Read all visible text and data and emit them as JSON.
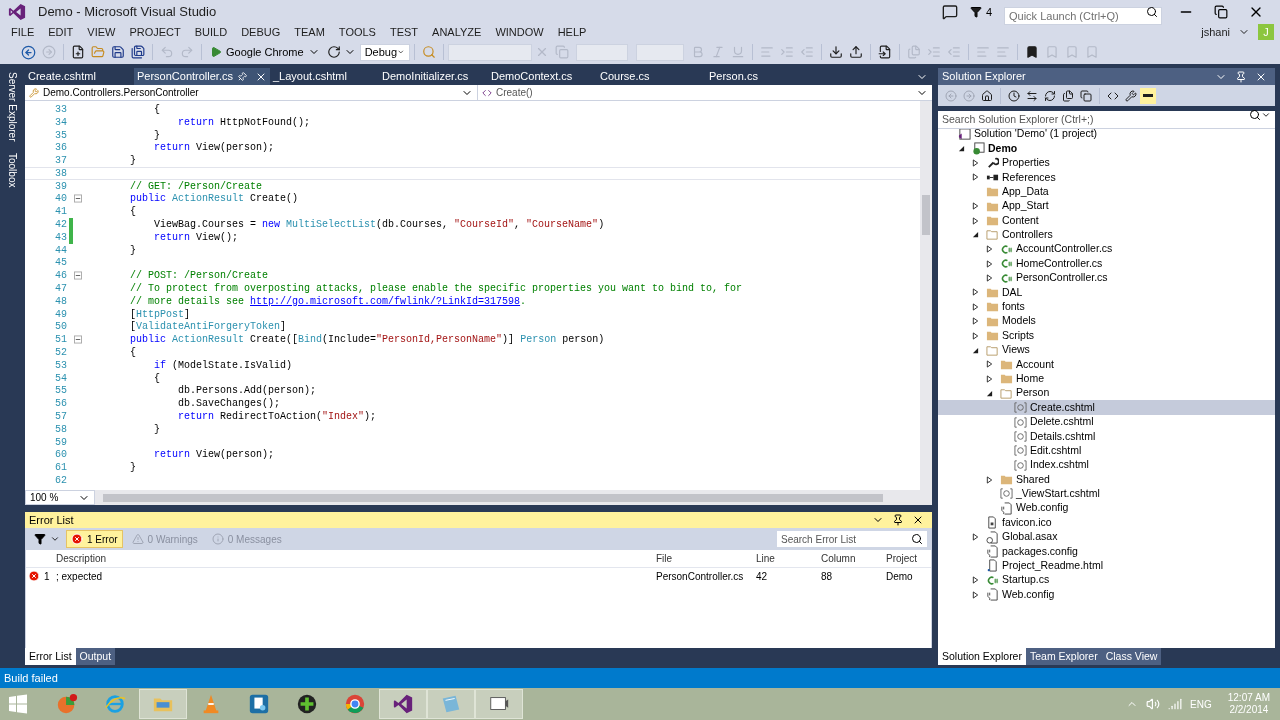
{
  "window": {
    "title": "Demo - Microsoft Visual Studio"
  },
  "title_bar": {
    "notification_count": "4",
    "quick_launch": {
      "placeholder": "Quick Launch (Ctrl+Q)"
    },
    "user": {
      "name": "jshani",
      "initial": "J"
    }
  },
  "menu": [
    "FILE",
    "EDIT",
    "VIEW",
    "PROJECT",
    "BUILD",
    "DEBUG",
    "TEAM",
    "TOOLS",
    "TEST",
    "ANALYZE",
    "WINDOW",
    "HELP"
  ],
  "toolbar": {
    "run_target": "Google Chrome",
    "configuration": "Debug"
  },
  "side_tabs": [
    "Server Explorer",
    "Toolbox"
  ],
  "editor": {
    "tabs": [
      {
        "label": "Create.cshtml",
        "selected": false
      },
      {
        "label": "PersonController.cs",
        "selected": true
      },
      {
        "label": "_Layout.cshtml",
        "selected": false
      },
      {
        "label": "DemoInitializer.cs",
        "selected": false
      },
      {
        "label": "DemoContext.cs",
        "selected": false
      },
      {
        "label": "Course.cs",
        "selected": false
      },
      {
        "label": "Person.cs",
        "selected": false
      }
    ],
    "type_dropdown": "Demo.Controllers.PersonController",
    "member_dropdown": "Create()",
    "zoom": "100 %",
    "lines": [
      {
        "number": "33",
        "tokens": [
          {
            "kind": "plain",
            "text": "            {"
          }
        ]
      },
      {
        "number": "34",
        "tokens": [
          {
            "kind": "keyword",
            "text": "                return"
          },
          {
            "kind": "plain",
            "text": " HttpNotFound();"
          }
        ]
      },
      {
        "number": "35",
        "tokens": [
          {
            "kind": "plain",
            "text": "            }"
          }
        ]
      },
      {
        "number": "36",
        "tokens": [
          {
            "kind": "keyword",
            "text": "            return"
          },
          {
            "kind": "plain",
            "text": " View(person);"
          }
        ]
      },
      {
        "number": "37",
        "tokens": [
          {
            "kind": "plain",
            "text": "        }"
          }
        ]
      },
      {
        "number": "38",
        "current": true
      },
      {
        "number": "39",
        "tokens": [
          {
            "kind": "comment",
            "text": "        // GET: /Person/Create"
          }
        ]
      },
      {
        "number": "40",
        "foldable": true,
        "tokens": [
          {
            "kind": "keyword",
            "text": "        public "
          },
          {
            "kind": "type",
            "text": "ActionResult"
          },
          {
            "kind": "plain",
            "text": " Create()"
          }
        ]
      },
      {
        "number": "41",
        "tokens": [
          {
            "kind": "plain",
            "text": "        {"
          }
        ]
      },
      {
        "number": "42",
        "changed": true,
        "tokens": [
          {
            "kind": "plain",
            "text": "            ViewBag.Courses = "
          },
          {
            "kind": "keyword",
            "text": "new "
          },
          {
            "kind": "type",
            "text": "MultiSelectList"
          },
          {
            "kind": "plain",
            "text": "(db.Courses, "
          },
          {
            "kind": "string",
            "text": "\"CourseId\""
          },
          {
            "kind": "plain",
            "text": ", "
          },
          {
            "kind": "string",
            "text": "\"CourseName\""
          },
          {
            "kind": "plain",
            "text": ")"
          }
        ]
      },
      {
        "number": "43",
        "changed": true,
        "tokens": [
          {
            "kind": "keyword",
            "text": "            return"
          },
          {
            "kind": "plain",
            "text": " View();"
          }
        ]
      },
      {
        "number": "44",
        "tokens": [
          {
            "kind": "plain",
            "text": "        }"
          }
        ]
      },
      {
        "number": "45"
      },
      {
        "number": "46",
        "foldable": true,
        "tokens": [
          {
            "kind": "comment",
            "text": "        // POST: /Person/Create"
          }
        ]
      },
      {
        "number": "47",
        "tokens": [
          {
            "kind": "comment",
            "text": "        // To protect from overposting attacks, please enable the specific properties you want to bind to, for"
          }
        ]
      },
      {
        "number": "48",
        "tokens": [
          {
            "kind": "comment",
            "text": "        // more details see "
          },
          {
            "kind": "link",
            "text": "http://go.microsoft.com/fwlink/?LinkId=317598"
          },
          {
            "kind": "comment",
            "text": "."
          }
        ]
      },
      {
        "number": "49",
        "tokens": [
          {
            "kind": "plain",
            "text": "        ["
          },
          {
            "kind": "type",
            "text": "HttpPost"
          },
          {
            "kind": "plain",
            "text": "]"
          }
        ]
      },
      {
        "number": "50",
        "tokens": [
          {
            "kind": "plain",
            "text": "        ["
          },
          {
            "kind": "type",
            "text": "ValidateAntiForgeryToken"
          },
          {
            "kind": "plain",
            "text": "]"
          }
        ]
      },
      {
        "number": "51",
        "foldable": true,
        "tokens": [
          {
            "kind": "keyword",
            "text": "        public "
          },
          {
            "kind": "type",
            "text": "ActionResult"
          },
          {
            "kind": "plain",
            "text": " Create(["
          },
          {
            "kind": "type",
            "text": "Bind"
          },
          {
            "kind": "plain",
            "text": "(Include="
          },
          {
            "kind": "string",
            "text": "\"PersonId,PersonName\""
          },
          {
            "kind": "plain",
            "text": ")] "
          },
          {
            "kind": "type",
            "text": "Person"
          },
          {
            "kind": "plain",
            "text": " person)"
          }
        ]
      },
      {
        "number": "52",
        "tokens": [
          {
            "kind": "plain",
            "text": "        {"
          }
        ]
      },
      {
        "number": "53",
        "tokens": [
          {
            "kind": "keyword",
            "text": "            if"
          },
          {
            "kind": "plain",
            "text": " (ModelState.IsValid)"
          }
        ]
      },
      {
        "number": "54",
        "tokens": [
          {
            "kind": "plain",
            "text": "            {"
          }
        ]
      },
      {
        "number": "55",
        "tokens": [
          {
            "kind": "plain",
            "text": "                db.Persons.Add(person);"
          }
        ]
      },
      {
        "number": "56",
        "tokens": [
          {
            "kind": "plain",
            "text": "                db.SaveChanges();"
          }
        ]
      },
      {
        "number": "57",
        "tokens": [
          {
            "kind": "keyword",
            "text": "                return"
          },
          {
            "kind": "plain",
            "text": " RedirectToAction("
          },
          {
            "kind": "string",
            "text": "\"Index\""
          },
          {
            "kind": "plain",
            "text": ");"
          }
        ]
      },
      {
        "number": "58",
        "tokens": [
          {
            "kind": "plain",
            "text": "            }"
          }
        ]
      },
      {
        "number": "59"
      },
      {
        "number": "60",
        "tokens": [
          {
            "kind": "keyword",
            "text": "            return"
          },
          {
            "kind": "plain",
            "text": " View(person);"
          }
        ]
      },
      {
        "number": "61",
        "tokens": [
          {
            "kind": "plain",
            "text": "        }"
          }
        ]
      },
      {
        "number": "62"
      }
    ]
  },
  "error_list": {
    "title": "Error List",
    "filters": [
      {
        "kind": "error",
        "label": "1 Error",
        "selected": true
      },
      {
        "kind": "warning",
        "label": "0 Warnings",
        "selected": false
      },
      {
        "kind": "message",
        "label": "0 Messages",
        "selected": false
      }
    ],
    "search": {
      "placeholder": "Search Error List"
    },
    "columns": [
      "Description",
      "File",
      "Line",
      "Column",
      "Project"
    ],
    "rows": [
      {
        "kind": "error",
        "number": "1",
        "description": "; expected",
        "file": "PersonController.cs",
        "line": "42",
        "column": "88",
        "project": "Demo"
      }
    ]
  },
  "bottom_tabs": [
    {
      "label": "Error List",
      "selected": true
    },
    {
      "label": "Output",
      "selected": false
    }
  ],
  "solution_explorer": {
    "title": "Solution Explorer",
    "search": {
      "placeholder": "Search Solution Explorer (Ctrl+;)"
    },
    "tree": [
      {
        "label": "Solution 'Demo' (1 project)",
        "kind": "solution",
        "selected": false,
        "children": [
          {
            "label": "Demo",
            "kind": "project",
            "startup": true,
            "expanded": true,
            "selected": false,
            "children": [
              {
                "label": "Properties",
                "kind": "properties",
                "expanded": false,
                "selected": false
              },
              {
                "label": "References",
                "kind": "references",
                "expanded": false,
                "selected": false
              },
              {
                "label": "App_Data",
                "kind": "folder",
                "selected": false
              },
              {
                "label": "App_Start",
                "kind": "folder",
                "expanded": false,
                "selected": false
              },
              {
                "label": "Content",
                "kind": "folder",
                "expanded": false,
                "selected": false
              },
              {
                "label": "Controllers",
                "kind": "folder",
                "expanded": true,
                "selected": false,
                "children": [
                  {
                    "label": "AccountController.cs",
                    "kind": "csharp",
                    "expanded": false,
                    "selected": false
                  },
                  {
                    "label": "HomeController.cs",
                    "kind": "csharp",
                    "expanded": false,
                    "selected": false
                  },
                  {
                    "label": "PersonController.cs",
                    "kind": "csharp",
                    "expanded": false,
                    "selected": false
                  }
                ]
              },
              {
                "label": "DAL",
                "kind": "folder",
                "expanded": false,
                "selected": false
              },
              {
                "label": "fonts",
                "kind": "folder",
                "expanded": false,
                "selected": false
              },
              {
                "label": "Models",
                "kind": "folder",
                "expanded": false,
                "selected": false
              },
              {
                "label": "Scripts",
                "kind": "folder",
                "expanded": false,
                "selected": false
              },
              {
                "label": "Views",
                "kind": "folder",
                "expanded": true,
                "selected": false,
                "children": [
                  {
                    "label": "Account",
                    "kind": "folder",
                    "expanded": false,
                    "selected": false
                  },
                  {
                    "label": "Home",
                    "kind": "folder",
                    "expanded": false,
                    "selected": false
                  },
                  {
                    "label": "Person",
                    "kind": "folder",
                    "expanded": true,
                    "selected": false,
                    "children": [
                      {
                        "label": "Create.cshtml",
                        "kind": "razor",
                        "selected": true
                      },
                      {
                        "label": "Delete.cshtml",
                        "kind": "razor",
                        "selected": false
                      },
                      {
                        "label": "Details.cshtml",
                        "kind": "razor",
                        "selected": false
                      },
                      {
                        "label": "Edit.cshtml",
                        "kind": "razor",
                        "selected": false
                      },
                      {
                        "label": "Index.cshtml",
                        "kind": "razor",
                        "selected": false
                      }
                    ]
                  },
                  {
                    "label": "Shared",
                    "kind": "folder",
                    "expanded": false,
                    "selected": false
                  },
                  {
                    "label": "_ViewStart.cshtml",
                    "kind": "razor",
                    "selected": false
                  },
                  {
                    "label": "Web.config",
                    "kind": "config",
                    "selected": false
                  }
                ]
              },
              {
                "label": "favicon.ico",
                "kind": "file",
                "selected": false
              },
              {
                "label": "Global.asax",
                "kind": "asax",
                "expanded": false,
                "selected": false
              },
              {
                "label": "packages.config",
                "kind": "config",
                "selected": false
              },
              {
                "label": "Project_Readme.html",
                "kind": "html",
                "selected": false
              },
              {
                "label": "Startup.cs",
                "kind": "csharp",
                "expanded": false,
                "selected": false
              },
              {
                "label": "Web.config",
                "kind": "config",
                "expanded": false,
                "selected": false
              }
            ]
          }
        ]
      }
    ],
    "tabs": [
      {
        "label": "Solution Explorer",
        "selected": true
      },
      {
        "label": "Team Explorer",
        "selected": false
      },
      {
        "label": "Class View",
        "selected": false
      }
    ]
  },
  "status_bar": {
    "text": "Build failed"
  },
  "taskbar": {
    "apps": [
      {
        "kind": "ball",
        "running": false
      },
      {
        "kind": "globe",
        "running": false
      },
      {
        "kind": "folder",
        "running": true
      },
      {
        "kind": "cone",
        "running": false
      },
      {
        "kind": "gear",
        "running": false
      },
      {
        "kind": "plus",
        "running": false
      },
      {
        "kind": "chrome",
        "running": false
      },
      {
        "kind": "studio",
        "running": true
      },
      {
        "kind": "notebook",
        "running": true
      },
      {
        "kind": "window",
        "running": true
      }
    ],
    "language": "ENG",
    "time": "12:07 AM",
    "date": "2/2/2014"
  }
}
